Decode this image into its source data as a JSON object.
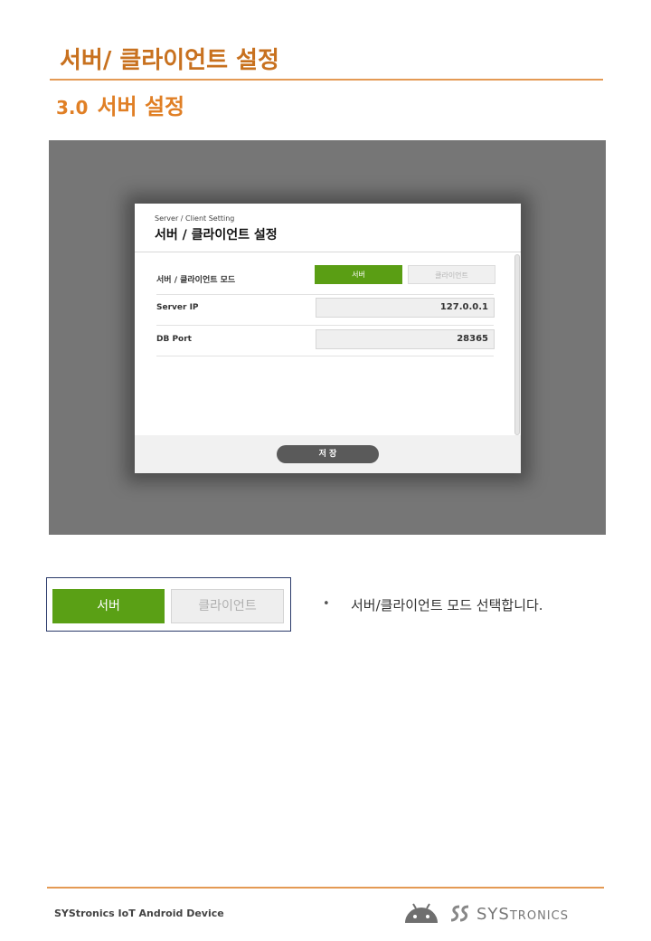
{
  "header": {
    "page_title": "서버/ 클라이언트 설정",
    "section_number": "3.0",
    "section_title": "서버 설정"
  },
  "dialog": {
    "subtitle": "Server / Client Setting",
    "title": "서버 / 클라이언트 설정",
    "rows": {
      "mode_label": "서버 / 클라이언트 모드",
      "server_button": "서버",
      "client_button": "클라이언트",
      "server_ip_label": "Server IP",
      "server_ip_value": "127.0.0.1",
      "db_port_label": "DB Port",
      "db_port_value": "28365"
    },
    "save_button": "저 장"
  },
  "callout": {
    "server_button": "서버",
    "client_button": "클라이언트",
    "bullet": "•",
    "description": "서버/클라이언트 모드 선택합니다."
  },
  "footer": {
    "device_text": "SYStronics IoT Android Device",
    "brand_prefix": "SYS",
    "brand_suffix": "TRONICS"
  },
  "colors": {
    "accent_orange": "#e07f25",
    "server_green": "#5a9e14",
    "screen_gray": "#767676"
  }
}
